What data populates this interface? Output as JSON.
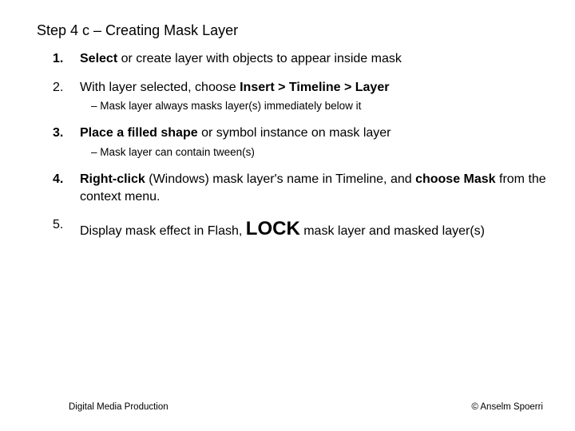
{
  "title": "Step 4 c – Creating Mask Layer",
  "items": [
    {
      "num_bold": true,
      "runs": [
        {
          "t": "Select",
          "bold": true
        },
        {
          "t": " or create layer with objects to appear inside mask"
        }
      ]
    },
    {
      "num_bold": false,
      "runs": [
        {
          "t": "With layer selected, choose "
        },
        {
          "t": "Insert > Timeline > Layer",
          "bold": true
        }
      ],
      "sub": [
        {
          "t": "–   Mask layer always masks layer(s) immediately below it"
        }
      ]
    },
    {
      "num_bold": true,
      "runs": [
        {
          "t": "Place a filled shape",
          "bold": true
        },
        {
          "t": " or symbol instance on mask layer"
        }
      ],
      "sub": [
        {
          "t": "–   Mask layer can contain tween(s)"
        }
      ]
    },
    {
      "num_bold": true,
      "runs": [
        {
          "t": "Right-click",
          "bold": true
        },
        {
          "t": " (Windows) mask layer's name in Timeline, and "
        },
        {
          "t": "choose Mask",
          "bold": true
        },
        {
          "t": " from the context menu."
        }
      ]
    },
    {
      "num_bold": false,
      "runs": [
        {
          "t": "Display mask effect in Flash, "
        },
        {
          "t": "LOCK",
          "bold": true,
          "cls": "lock"
        },
        {
          "t": " mask layer and masked layer(s)"
        }
      ]
    }
  ],
  "footer": {
    "left": "Digital Media Production",
    "right": "© Anselm Spoerri"
  }
}
